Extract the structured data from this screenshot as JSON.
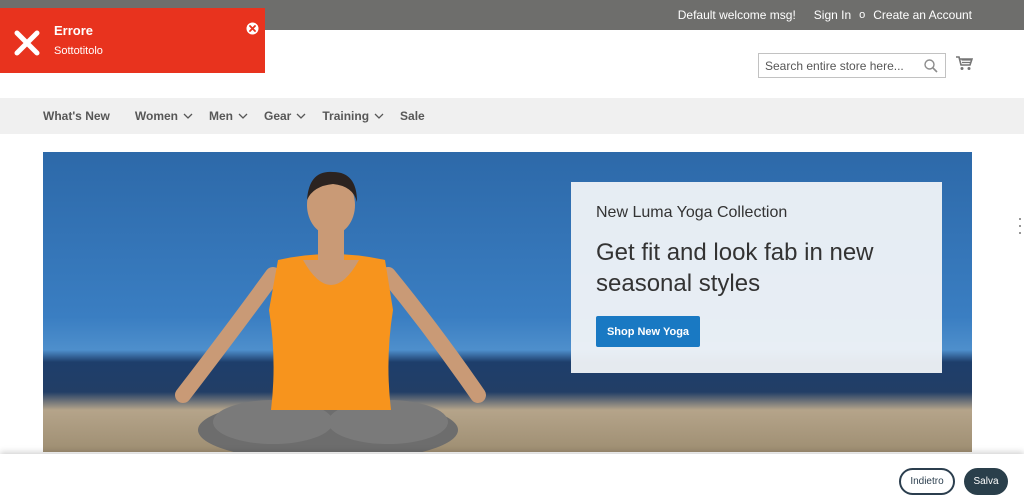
{
  "topbar": {
    "welcome": "Default welcome msg!",
    "sign_in": "Sign In",
    "separator": "o",
    "create_account": "Create an Account"
  },
  "search": {
    "placeholder": "Search entire store here..."
  },
  "nav": {
    "items": [
      {
        "label": "What's New",
        "has_dropdown": false
      },
      {
        "label": "Women",
        "has_dropdown": true
      },
      {
        "label": "Men",
        "has_dropdown": true
      },
      {
        "label": "Gear",
        "has_dropdown": true
      },
      {
        "label": "Training",
        "has_dropdown": true
      },
      {
        "label": "Sale",
        "has_dropdown": false
      }
    ]
  },
  "hero": {
    "kicker": "New Luma Yoga Collection",
    "headline": "Get fit and look fab in new seasonal styles",
    "cta": "Shop New Yoga"
  },
  "toast": {
    "title": "Errore",
    "subtitle": "Sottotitolo",
    "color": "#e8331e"
  },
  "footer_actions": {
    "back": "Indietro",
    "save": "Salva"
  },
  "colors": {
    "topbar": "#6e6e6c",
    "nav_bg": "#f0f0f0",
    "cta": "#1979c3",
    "save_btn": "#2a3f4b"
  }
}
